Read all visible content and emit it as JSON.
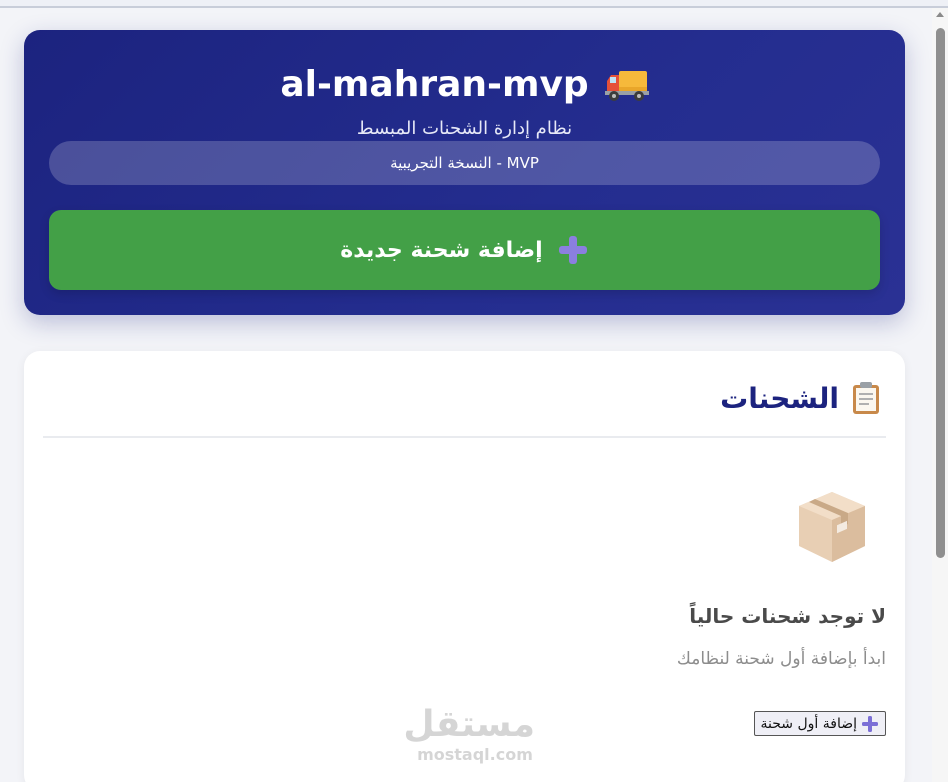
{
  "header": {
    "app_title": "al-mahran-mvp",
    "subtitle": "نظام إدارة الشحنات المبسط",
    "version_label": "MVP - النسخة التجريبية",
    "add_shipment_label": "إضافة شحنة جديدة",
    "title_icon": "truck-icon",
    "button_icon": "plus-icon"
  },
  "shipments": {
    "section_title": "الشحنات",
    "section_icon": "clipboard-icon",
    "empty_icon": "package-box-icon",
    "empty_title": "لا توجد شحنات حالياً",
    "empty_hint": "ابدأ بإضافة أول شحنة لنظامك",
    "first_add_label": "إضافة أول شحنة"
  },
  "watermark": {
    "arabic": "مستقل",
    "latin": "mostaql.com"
  },
  "colors": {
    "header_bg": "#1c237f",
    "button_green": "#43a047",
    "title_blue": "#1c237f",
    "plus_purple": "#7b6fd6"
  }
}
